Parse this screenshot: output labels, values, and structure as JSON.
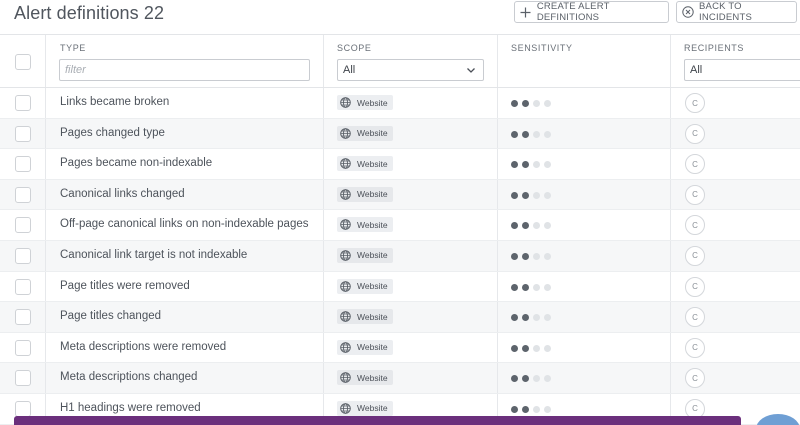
{
  "header": {
    "title": "Alert definitions",
    "count": "22",
    "create_button": "CREATE ALERT DEFINITIONS",
    "back_button": "BACK TO INCIDENTS"
  },
  "columns": {
    "type": "TYPE",
    "scope": "SCOPE",
    "sensitivity": "SENSITIVITY",
    "recipients": "RECIPIENTS"
  },
  "filters": {
    "type_placeholder": "filter",
    "scope_value": "All",
    "recipients_value": "All"
  },
  "rows": [
    {
      "type": "Links became broken",
      "scope": "Website",
      "sensitivity": 2,
      "recipient": "C"
    },
    {
      "type": "Pages changed type",
      "scope": "Website",
      "sensitivity": 2,
      "recipient": "C"
    },
    {
      "type": "Pages became non-indexable",
      "scope": "Website",
      "sensitivity": 2,
      "recipient": "C"
    },
    {
      "type": "Canonical links changed",
      "scope": "Website",
      "sensitivity": 2,
      "recipient": "C"
    },
    {
      "type": "Off-page canonical links on non-indexable pages",
      "scope": "Website",
      "sensitivity": 2,
      "recipient": "C"
    },
    {
      "type": "Canonical link target is not indexable",
      "scope": "Website",
      "sensitivity": 2,
      "recipient": "C"
    },
    {
      "type": "Page titles were removed",
      "scope": "Website",
      "sensitivity": 2,
      "recipient": "C"
    },
    {
      "type": "Page titles changed",
      "scope": "Website",
      "sensitivity": 2,
      "recipient": "C"
    },
    {
      "type": "Meta descriptions were removed",
      "scope": "Website",
      "sensitivity": 2,
      "recipient": "C"
    },
    {
      "type": "Meta descriptions changed",
      "scope": "Website",
      "sensitivity": 2,
      "recipient": "C"
    },
    {
      "type": "H1 headings were removed",
      "scope": "Website",
      "sensitivity": 2,
      "recipient": "C"
    }
  ],
  "sensitivity_max": 4,
  "colors": {
    "bottom_bar": "#6b2f7c",
    "fab": "#6f9fd4",
    "dot_on": "#5d646c",
    "dot_off": "#e0e3e6"
  },
  "icons": {
    "create": "plus-icon",
    "back": "close-circle-icon",
    "scope": "globe-icon",
    "select": "chevron-down-icon"
  }
}
